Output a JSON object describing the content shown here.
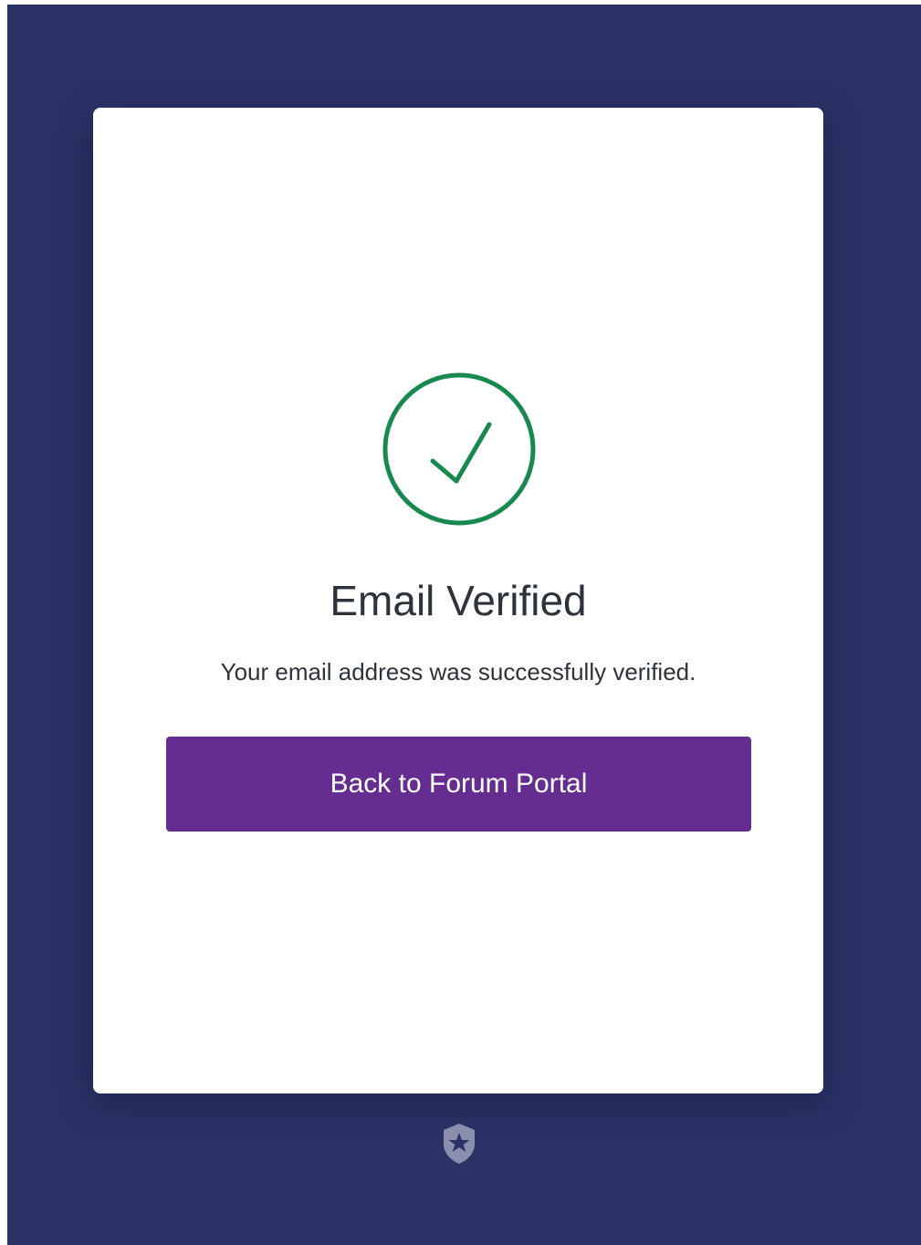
{
  "page": {
    "background_color": "#2a3266"
  },
  "card": {
    "status_icon": "checkmark-circle-icon",
    "status_color": "#17884e",
    "title": "Email Verified",
    "message": "Your email address was successfully verified.",
    "button_label": "Back to Forum Portal",
    "button_color": "#662d91"
  },
  "footer": {
    "icon": "auth0-shield-logo-icon"
  }
}
